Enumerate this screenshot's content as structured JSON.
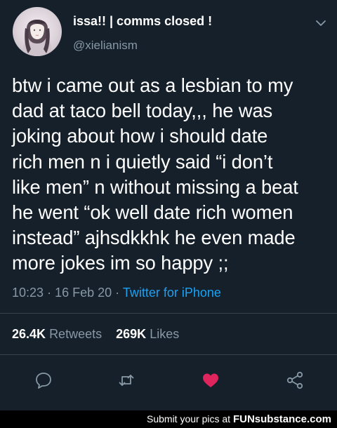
{
  "author": {
    "display_name": "issa!! | comms closed !",
    "handle": "@xielianism"
  },
  "tweet": {
    "text": "btw i came out as a lesbian to my\ndad at taco bell today,,, he was\njoking about how i should date\nrich men n i quietly said “i don’t\nlike men” n without missing a beat\nhe went “ok well date rich women\ninstead” ajhsdkkhk he even made\nmore jokes im so happy ;;",
    "time": "10:23",
    "date": "16 Feb 20",
    "separator": "·",
    "source": "Twitter for iPhone"
  },
  "stats": {
    "retweets_count": "26.4K",
    "retweets_label": "Retweets",
    "likes_count": "269K",
    "likes_label": "Likes"
  },
  "actions": {
    "reply_icon": "reply-icon",
    "retweet_icon": "retweet-icon",
    "like_icon": "heart-icon",
    "share_icon": "share-icon",
    "liked": true,
    "like_color": "#e0245e"
  },
  "footer": {
    "text": "Submit your pics at",
    "brand_part1": "FUN",
    "brand_part2": "substance",
    "brand_part3": ".com"
  },
  "colors": {
    "background": "#15202b",
    "secondary_text": "#8899a6",
    "link": "#1da1f2",
    "divider": "#38444d"
  }
}
